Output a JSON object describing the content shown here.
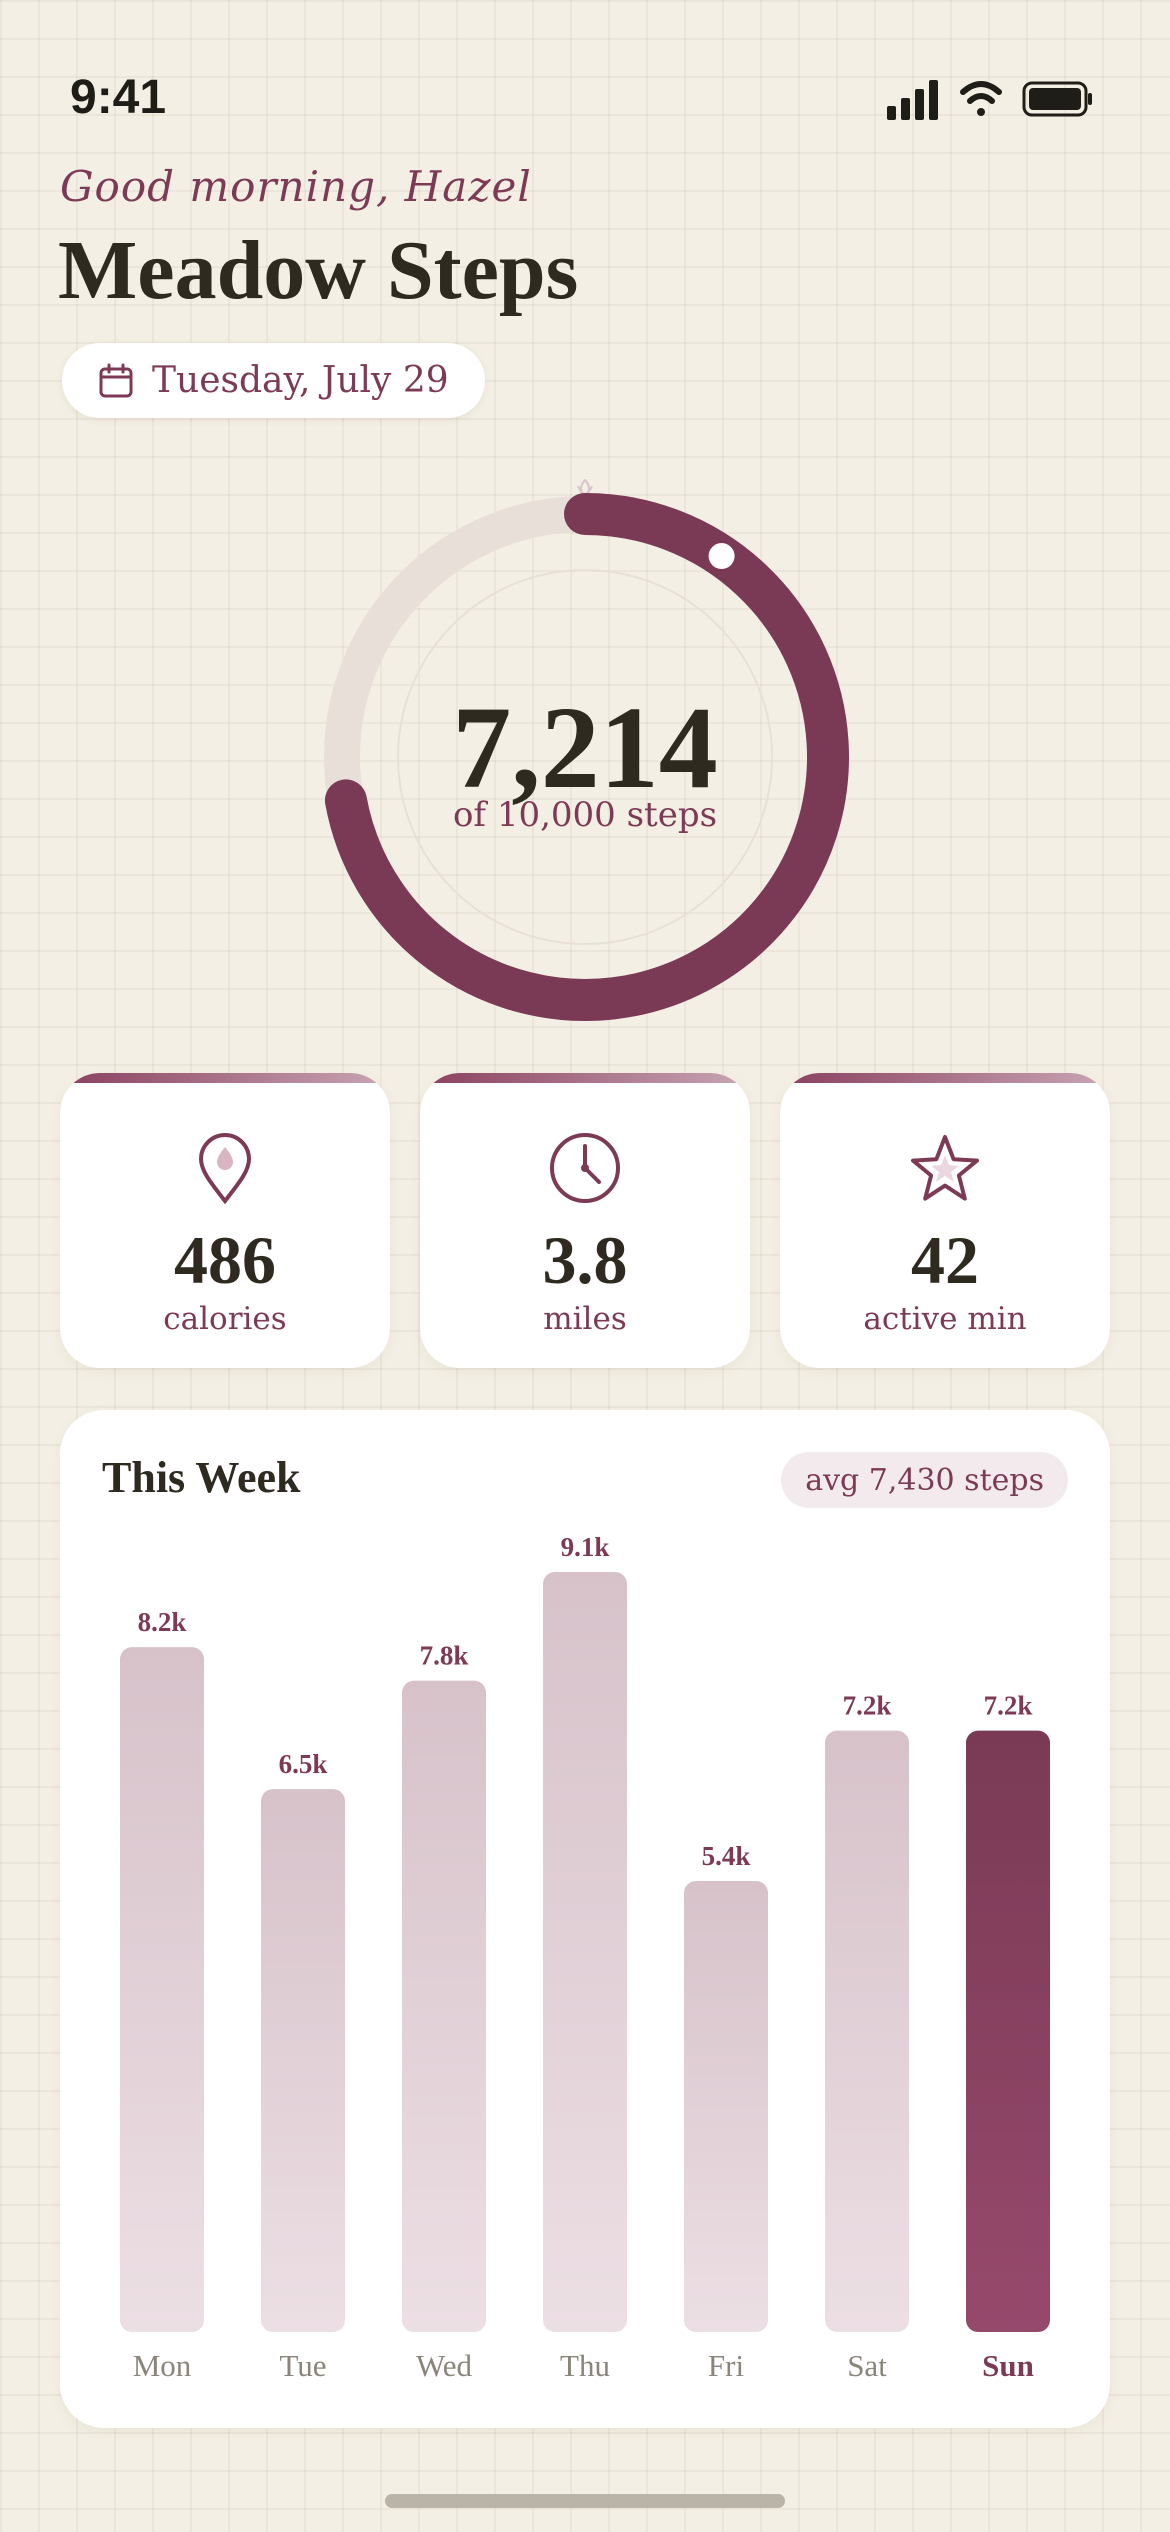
{
  "status_bar": {
    "time": "9:41",
    "icons": [
      "signal-icon",
      "wifi-icon",
      "battery-icon"
    ]
  },
  "header": {
    "greeting": "Good morning, Hazel",
    "title": "Meadow Steps",
    "date": "Tuesday, July 29"
  },
  "progress": {
    "steps": "7,214",
    "goal_text": "of 10,000 steps",
    "fraction": 0.7214
  },
  "stats": [
    {
      "icon": "location-pin-icon",
      "value": "486",
      "label": "calories"
    },
    {
      "icon": "clock-icon",
      "value": "3.8",
      "label": "miles"
    },
    {
      "icon": "star-icon",
      "value": "42",
      "label": "active min"
    }
  ],
  "week": {
    "title": "This Week",
    "avg": "avg 7,430 steps"
  },
  "chart_data": {
    "type": "bar",
    "categories": [
      "Mon",
      "Tue",
      "Wed",
      "Thu",
      "Fri",
      "Sat",
      "Sun"
    ],
    "values": [
      8.2,
      6.5,
      7.8,
      9.1,
      5.4,
      7.2,
      7.2
    ],
    "labels": [
      "8.2k",
      "6.5k",
      "7.8k",
      "9.1k",
      "5.4k",
      "7.2k",
      "7.2k"
    ],
    "highlight_index": 6,
    "ylim": [
      0,
      9.1
    ],
    "grid": false
  },
  "colors": {
    "accent": "#7c3a55",
    "accent_dark": "#7a3a55",
    "bar_light": "#d9c4cc",
    "track": "#e8e0d8",
    "background": "#f4efe4"
  }
}
